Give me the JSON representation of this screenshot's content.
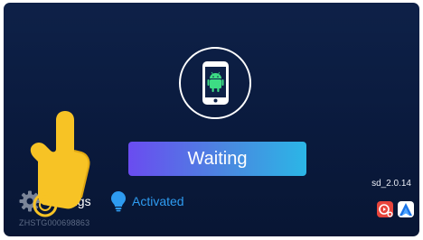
{
  "main": {
    "status_button_label": "Waiting",
    "version": "sd_2.0.14"
  },
  "footer": {
    "settings_label": "Settings",
    "activation_label": "Activated",
    "serial_number": "ZHSTG000698863"
  },
  "icons": {
    "phone": "android-phone-icon",
    "settings": "gear-icon",
    "activation": "bulb-icon",
    "pointer": "pointing-hand-icon",
    "app_1": "carplay-app-icon",
    "app_2": "android-auto-app-icon"
  },
  "colors": {
    "background": "#0a1a3d",
    "accent_blue": "#2e9bf0",
    "android_green": "#3ddc84",
    "hand_yellow": "#f7c325"
  }
}
